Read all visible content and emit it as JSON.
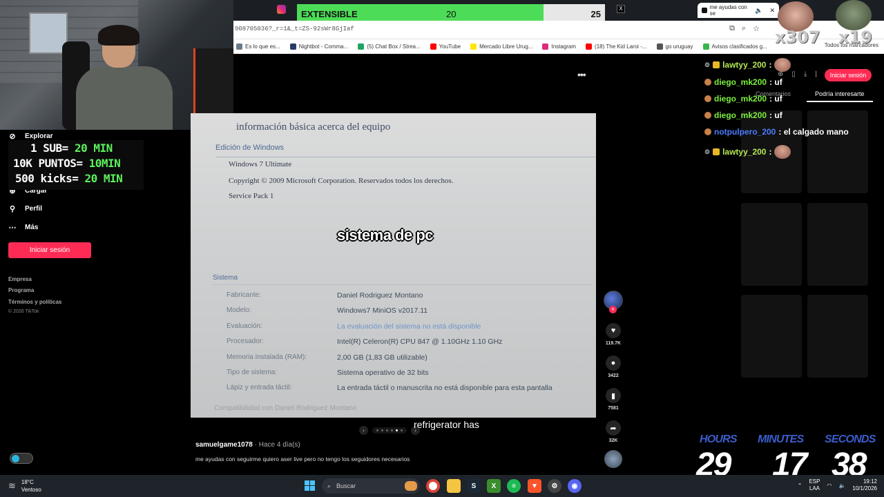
{
  "browser": {
    "active_tab_title": "me ayudas con se",
    "url": "908705036?_r=1&_t=ZS-92sWr8GjIaf",
    "bookmarks": [
      {
        "label": "Es lo que es...",
        "color": "#6a7a88"
      },
      {
        "label": "Nightbot - Comma...",
        "color": "#2b3a67"
      },
      {
        "label": "(5) Chat Box / Strea...",
        "color": "#1fa463"
      },
      {
        "label": "YouTube",
        "color": "#ff0000"
      },
      {
        "label": "Mercado Libre Urug...",
        "color": "#ffe600"
      },
      {
        "label": "Instagram",
        "color": "#dd2a7b"
      },
      {
        "label": "(18) The Kid Laroi -...",
        "color": "#ff0000"
      },
      {
        "label": "go uruguay",
        "color": "#555555"
      },
      {
        "label": "Avisos clasificados g...",
        "color": "#39b54a"
      }
    ],
    "all_bookmarks": "Todos los marcadores"
  },
  "progress": {
    "label": "EXTENSIBLE",
    "current": "20",
    "max": "25",
    "fraction": 0.8
  },
  "sidebar": {
    "explore": "Explorar",
    "upload": "Cargar",
    "profile": "Perfil",
    "more": "Más",
    "login": "Iniciar sesión",
    "footer": [
      "Empresa",
      "Programa",
      "Términos y políticas"
    ],
    "copyright": "© 2026 TikTok"
  },
  "sub_overlay": {
    "lines": [
      {
        "pre": "1 SUB= ",
        "val": "20 MIN"
      },
      {
        "pre": "10K PUNTOS= ",
        "val": "10MIN"
      },
      {
        "pre": "500 kicks= ",
        "val": "20 MIN"
      }
    ]
  },
  "video": {
    "title": "información básica acerca del equipo",
    "edition_header": "Edición de Windows",
    "edition": "Windows 7 Ultimate",
    "copyright": "Copyright © 2009 Microsoft Corporation. Reservados todos los derechos.",
    "service_pack": "Service Pack 1",
    "system_header": "Sistema",
    "caption": "sistema de pc",
    "specs": [
      {
        "label": "Fabricante:",
        "value": "Daniel Rodriguez Montano"
      },
      {
        "label": "Modelo:",
        "value": "Windows7 MiniOS v2017.11"
      },
      {
        "label": "Evaluación:",
        "value": "La evaluación del sistema no está disponible"
      },
      {
        "label": "Procesador:",
        "value": "Intel(R) Celeron(R) CPU 847 @ 1.10GHz   1.10 GHz"
      },
      {
        "label": "Memoria instalada (RAM):",
        "value": "2,00 GB (1,83 GB utilizable)"
      },
      {
        "label": "Tipo de sistema:",
        "value": "Sistema operativo de 32 bits"
      },
      {
        "label": "Lápiz y entrada táctil:",
        "value": "La entrada táctil o manuscrita no está disponible para esta pantalla"
      }
    ],
    "bottom_text": "Compatibilidad con Daniel Rodriguez Montano"
  },
  "subtitle": "refrigerator has",
  "post": {
    "author": "samuelgame1078",
    "time": " · Hace 4 día(s)",
    "description": "me ayudas con seguirme quiero aser live pero no tengo los seguidores necesarios"
  },
  "actions": {
    "likes": "119.7K",
    "comments": "3422",
    "saves": "7581",
    "shares": "32K"
  },
  "right_panel": {
    "login": "Iniciar sesión",
    "tabs": [
      "Comentarios",
      "Podría interesarte"
    ]
  },
  "chat": [
    {
      "user": "lawtyy_200",
      "color": "#b5e853",
      "msg": ":",
      "emote": true,
      "badge": true
    },
    {
      "user": "diego_mk200",
      "color": "#7cf03c",
      "msg": ": uf",
      "emote": false,
      "badge": false
    },
    {
      "user": "diego_mk200",
      "color": "#7cf03c",
      "msg": ": uf",
      "emote": false,
      "badge": false
    },
    {
      "user": "diego_mk200",
      "color": "#7cf03c",
      "msg": ": uf",
      "emote": false,
      "badge": false
    },
    {
      "user": "notpulpero_200",
      "color": "#4a7cff",
      "msg": ": el calgado mano",
      "emote": false,
      "badge": false
    },
    {
      "user": "lawtyy_200",
      "color": "#b5e853",
      "msg": ":",
      "emote": true,
      "badge": true
    }
  ],
  "emote_overlay": {
    "count1": "x307",
    "count2": "x19"
  },
  "timer": {
    "hours_label": "HOURS",
    "minutes_label": "MINUTES",
    "seconds_label": "SECONDS",
    "hours": "29",
    "minutes": "17",
    "seconds": "38"
  },
  "taskbar": {
    "temp": "18°C",
    "weather": "Ventoso",
    "search": "Buscar",
    "lang1": "ESP",
    "lang2": "LAA",
    "time": "19:12",
    "date": "10/1/2026"
  }
}
